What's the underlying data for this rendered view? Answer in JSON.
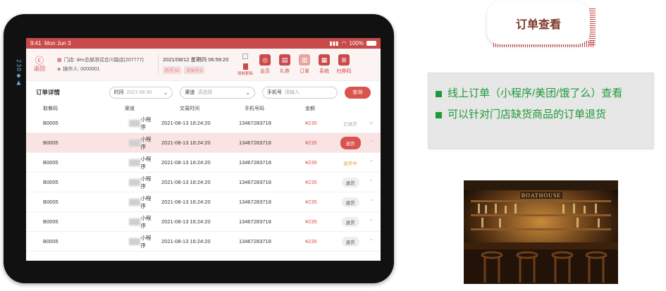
{
  "status_bar": {
    "time": "9:41",
    "date": "Mon Jun 3",
    "battery": "100%"
  },
  "header": {
    "back_label": "返回",
    "store": "门店: dev总部测试合川路店(207777)",
    "operator": "操作人: 0000001",
    "datetime": "2021/08/12 星期四  06:59:20",
    "tag_machine": "机号:01",
    "tag_shift": "交易号:5",
    "sync_label": "强制更新",
    "tools": [
      {
        "label": "会员",
        "icon": "member-icon"
      },
      {
        "label": "礼券",
        "icon": "coupon-icon"
      },
      {
        "label": "订单",
        "icon": "order-icon"
      },
      {
        "label": "系统",
        "icon": "system-icon"
      },
      {
        "label": "扫券码",
        "icon": "scan-icon"
      }
    ]
  },
  "filters": {
    "title": "订单详情",
    "time_label": "时间",
    "time_value": "2021-08-30",
    "channel_label": "渠道",
    "channel_placeholder": "请选择",
    "phone_label": "手机号",
    "phone_placeholder": "请输入",
    "query_label": "查询"
  },
  "table": {
    "headers": [
      "取餐码",
      "渠道",
      "交易时间",
      "手机号码",
      "金额"
    ],
    "rows": [
      {
        "code": "B0005",
        "channel": "小程序",
        "time": "2021-08-13 16:24:20",
        "phone": "13467283718",
        "amount": "¥235",
        "status": "已退货",
        "status_type": "done"
      },
      {
        "code": "B0005",
        "channel": "小程序",
        "time": "2021-08-13 16:24:20",
        "phone": "13467283718",
        "amount": "¥235",
        "status": "退货",
        "status_type": "primary"
      },
      {
        "code": "B0005",
        "channel": "小程序",
        "time": "2021-08-13 16:24:20",
        "phone": "13467283718",
        "amount": "¥235",
        "status": "退货中",
        "status_type": "pending"
      },
      {
        "code": "B0005",
        "channel": "小程序",
        "time": "2021-08-13 16:24:20",
        "phone": "13467283718",
        "amount": "¥235",
        "status": "退货",
        "status_type": "normal"
      },
      {
        "code": "B0005",
        "channel": "小程序",
        "time": "2021-08-13 16:24:20",
        "phone": "13467283718",
        "amount": "¥235",
        "status": "退货",
        "status_type": "normal"
      },
      {
        "code": "B0005",
        "channel": "小程序",
        "time": "2021-08-13 16:24:20",
        "phone": "13467283718",
        "amount": "¥235",
        "status": "退货",
        "status_type": "normal"
      },
      {
        "code": "B0005",
        "channel": "小程序",
        "time": "2021-08-13 16:24:20",
        "phone": "13467283718",
        "amount": "¥235",
        "status": "退货",
        "status_type": "normal"
      }
    ]
  },
  "slide": {
    "title": "订单查看",
    "bullets": [
      "线上订单（小程序/美团/饿了么）查看",
      "可以针对门店缺货商品的订单退货"
    ],
    "photo_sign": "BOATHOUSE"
  },
  "colors": {
    "brand": "#c94a4a",
    "bullet_green": "#1e9a3a"
  }
}
